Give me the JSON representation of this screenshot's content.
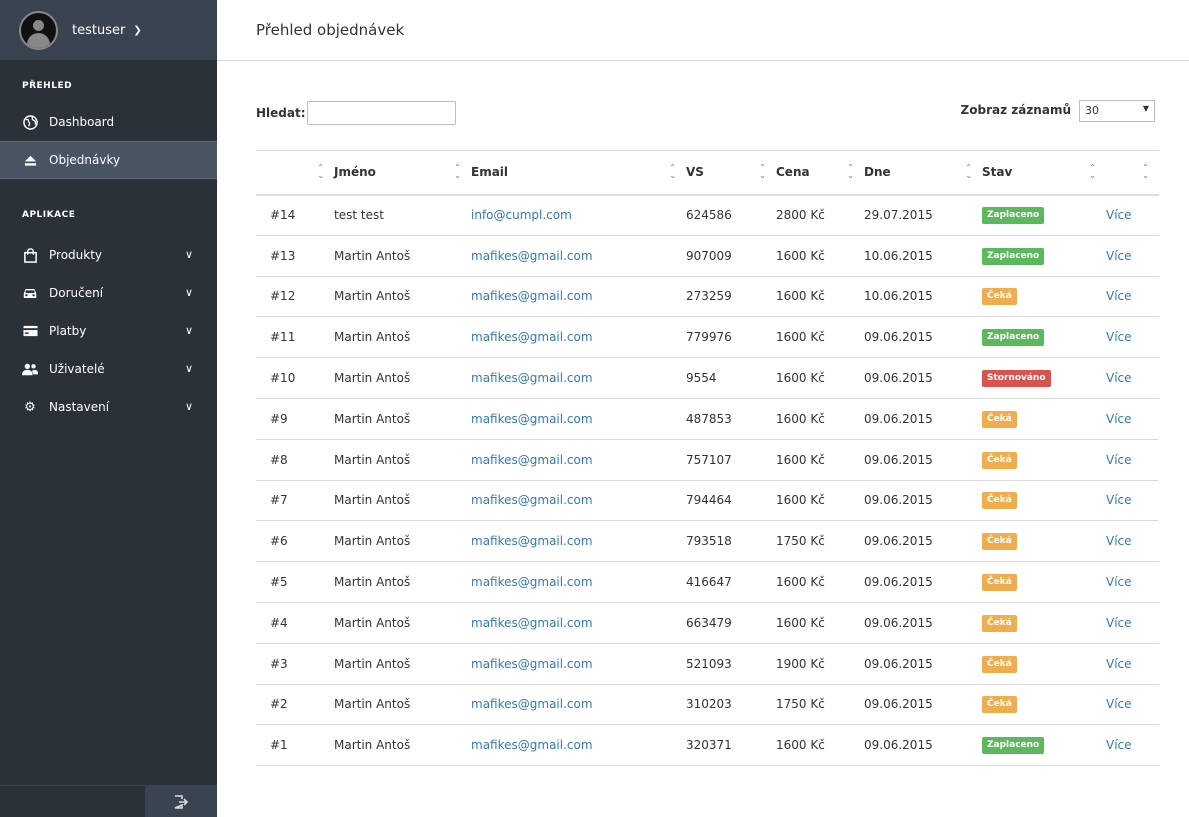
{
  "user": {
    "name": "testuser"
  },
  "sidebar": {
    "section_overview": "PŘEHLED",
    "overview_items": [
      {
        "label": "Dashboard",
        "icon": "globe-icon"
      },
      {
        "label": "Objednávky",
        "icon": "eject-icon"
      }
    ],
    "section_apps": "APLIKACE",
    "app_items": [
      {
        "label": "Produkty",
        "icon": "shopping-bag-icon"
      },
      {
        "label": "Doručení",
        "icon": "car-icon"
      },
      {
        "label": "Platby",
        "icon": "credit-card-icon"
      },
      {
        "label": "Uživatelé",
        "icon": "users-icon"
      },
      {
        "label": "Nastavení",
        "icon": "gear-icon"
      }
    ]
  },
  "page": {
    "title": "Přehled objednávek"
  },
  "toolbar": {
    "search_label": "Hledat:",
    "search_value": "",
    "per_page_label": "Zobraz záznamů",
    "per_page_value": "30"
  },
  "table": {
    "headers": [
      "",
      "Jméno",
      "Email",
      "VS",
      "Cena",
      "Dne",
      "Stav",
      ""
    ],
    "more_label": "Více",
    "rows": [
      {
        "id": "#14",
        "name": "test test",
        "email": "info@cumpl.com",
        "vs": "624586",
        "price": "2800 Kč",
        "date": "29.07.2015",
        "status": "Zaplaceno",
        "status_type": "zaplaceno"
      },
      {
        "id": "#13",
        "name": "Martin Antoš",
        "email": "mafikes@gmail.com",
        "vs": "907009",
        "price": "1600 Kč",
        "date": "10.06.2015",
        "status": "Zaplaceno",
        "status_type": "zaplaceno"
      },
      {
        "id": "#12",
        "name": "Martin Antoš",
        "email": "mafikes@gmail.com",
        "vs": "273259",
        "price": "1600 Kč",
        "date": "10.06.2015",
        "status": "Čeká",
        "status_type": "ceka"
      },
      {
        "id": "#11",
        "name": "Martin Antoš",
        "email": "mafikes@gmail.com",
        "vs": "779976",
        "price": "1600 Kč",
        "date": "09.06.2015",
        "status": "Zaplaceno",
        "status_type": "zaplaceno"
      },
      {
        "id": "#10",
        "name": "Martin Antoš",
        "email": "mafikes@gmail.com",
        "vs": "9554",
        "price": "1600 Kč",
        "date": "09.06.2015",
        "status": "Stornováno",
        "status_type": "stornovano"
      },
      {
        "id": "#9",
        "name": "Martin Antoš",
        "email": "mafikes@gmail.com",
        "vs": "487853",
        "price": "1600 Kč",
        "date": "09.06.2015",
        "status": "Čeká",
        "status_type": "ceka"
      },
      {
        "id": "#8",
        "name": "Martin Antoš",
        "email": "mafikes@gmail.com",
        "vs": "757107",
        "price": "1600 Kč",
        "date": "09.06.2015",
        "status": "Čeká",
        "status_type": "ceka"
      },
      {
        "id": "#7",
        "name": "Martin Antoš",
        "email": "mafikes@gmail.com",
        "vs": "794464",
        "price": "1600 Kč",
        "date": "09.06.2015",
        "status": "Čeká",
        "status_type": "ceka"
      },
      {
        "id": "#6",
        "name": "Martin Antoš",
        "email": "mafikes@gmail.com",
        "vs": "793518",
        "price": "1750 Kč",
        "date": "09.06.2015",
        "status": "Čeká",
        "status_type": "ceka"
      },
      {
        "id": "#5",
        "name": "Martin Antoš",
        "email": "mafikes@gmail.com",
        "vs": "416647",
        "price": "1600 Kč",
        "date": "09.06.2015",
        "status": "Čeká",
        "status_type": "ceka"
      },
      {
        "id": "#4",
        "name": "Martin Antoš",
        "email": "mafikes@gmail.com",
        "vs": "663479",
        "price": "1600 Kč",
        "date": "09.06.2015",
        "status": "Čeká",
        "status_type": "ceka"
      },
      {
        "id": "#3",
        "name": "Martin Antoš",
        "email": "mafikes@gmail.com",
        "vs": "521093",
        "price": "1900 Kč",
        "date": "09.06.2015",
        "status": "Čeká",
        "status_type": "ceka"
      },
      {
        "id": "#2",
        "name": "Martin Antoš",
        "email": "mafikes@gmail.com",
        "vs": "310203",
        "price": "1750 Kč",
        "date": "09.06.2015",
        "status": "Čeká",
        "status_type": "ceka"
      },
      {
        "id": "#1",
        "name": "Martin Antoš",
        "email": "mafikes@gmail.com",
        "vs": "320371",
        "price": "1600 Kč",
        "date": "09.06.2015",
        "status": "Zaplaceno",
        "status_type": "zaplaceno"
      }
    ]
  },
  "colors": {
    "sidebar_bg": "#2b3139",
    "sidebar_active": "#4a5563",
    "link": "#337ab7",
    "status_paid": "#5cb85c",
    "status_waiting": "#f0ad4e",
    "status_cancelled": "#d9534f"
  }
}
